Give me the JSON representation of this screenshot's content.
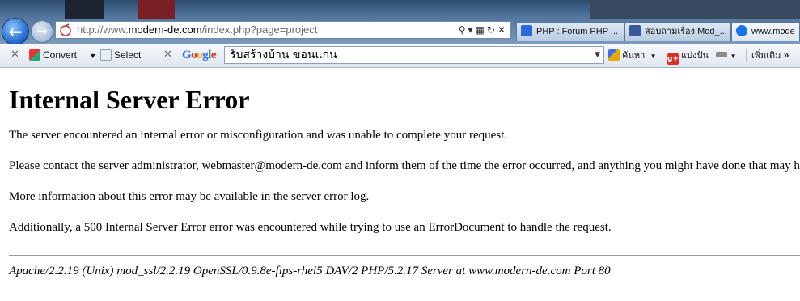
{
  "browser": {
    "address_url_prefix": "http://www.",
    "address_url_host": "modern-de.com",
    "address_url_path": "/index.php?page=project",
    "tabs": [
      {
        "label": "PHP : Forum PHP ...",
        "color": "#2a6ad8"
      },
      {
        "label": "สอบถามเรื่อง Mod_...",
        "color": "#3b5998"
      },
      {
        "label": "www.mode",
        "color": "#1a73e8"
      }
    ]
  },
  "toolbar": {
    "convert_label": "Convert",
    "select_label": "Select",
    "google_logo": "Google",
    "search_value": "รับสร้างบ้าน ขอนแก่น",
    "search_button_label": "ค้นหา",
    "share_label": "แบ่งปัน",
    "more_label": "เพิ่มเติม"
  },
  "page": {
    "heading": "Internal Server Error",
    "paragraphs": [
      "The server encountered an internal error or misconfiguration and was unable to complete your request.",
      "Please contact the server administrator, webmaster@modern-de.com and inform them of the time the error occurred, and anything you might have done that may h",
      "More information about this error may be available in the server error log.",
      "Additionally, a 500 Internal Server Error error was encountered while trying to use an ErrorDocument to handle the request."
    ],
    "server_signature": "Apache/2.2.19 (Unix) mod_ssl/2.2.19 OpenSSL/0.9.8e-fips-rhel5 DAV/2 PHP/5.2.17 Server at www.modern-de.com Port 80"
  },
  "colors": {
    "google_blue": "#3b6ef0",
    "google_red": "#d93025",
    "google_yellow": "#e8a600",
    "google_green": "#1e8e3e"
  }
}
